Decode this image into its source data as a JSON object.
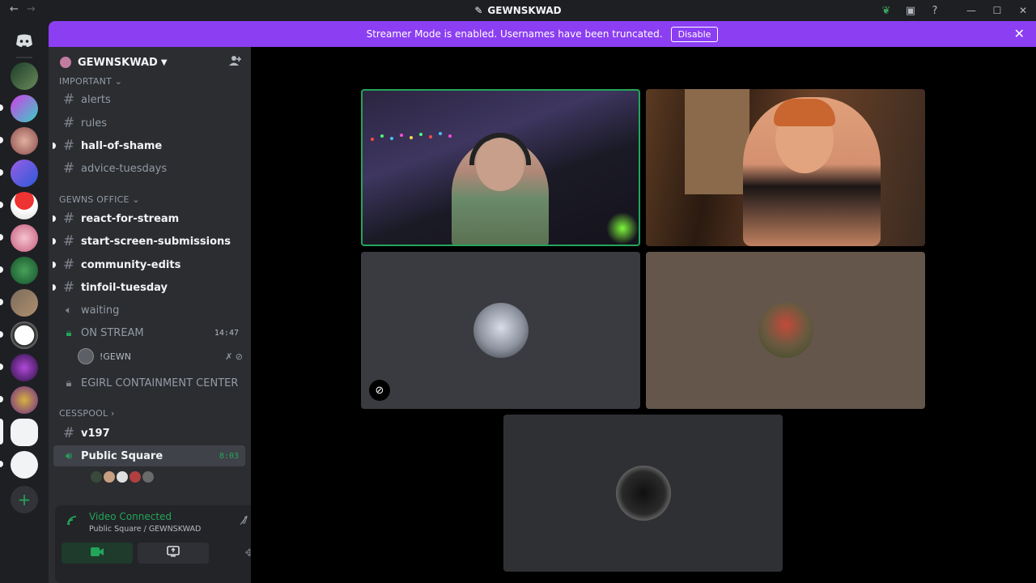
{
  "titlebar": {
    "back": "←",
    "forward": "→",
    "title": "GEWNSKWAD",
    "icons": [
      "leaf-icon",
      "stream-icon",
      "help-icon"
    ],
    "window": {
      "minimize": "—",
      "maximize": "☐",
      "close": "✕"
    }
  },
  "banner": {
    "message": "Streamer Mode is enabled. Usernames have been truncated.",
    "button": "Disable",
    "close": "✕"
  },
  "server": {
    "name": "GEWNSKWAD",
    "chevron": "⌄"
  },
  "categories": {
    "important": "IMPORTANT ⌄",
    "office": "GEWNS OFFICE ⌄",
    "cesspool": "CESSPOOL ›"
  },
  "channels": {
    "alerts": "alerts",
    "rules": "rules",
    "hall_of_shame": "hall-of-shame",
    "advice_tuesdays": "advice-tuesdays",
    "react_for_stream": "react-for-stream",
    "start_screen": "start-screen-submissions",
    "community_edits": "community-edits",
    "tinfoil_tuesday": "tinfoil-tuesday",
    "waiting": "waiting",
    "on_stream": "ON STREAM",
    "on_stream_time": "14:47",
    "egirl": "EGIRL CONTAINMENT CENTER",
    "v197": "v197",
    "public_square": "Public Square",
    "public_square_time": "8:03"
  },
  "voice_user": {
    "name": "!GEWN"
  },
  "panel": {
    "status": "Video Connected",
    "location": "Public Square / GEWNSKWAD"
  },
  "colors": {
    "accent_banner": "#8b3ef2",
    "connected_green": "#23a55a",
    "sidebar_bg": "#2b2d31",
    "rail_bg": "#1e1f22"
  }
}
